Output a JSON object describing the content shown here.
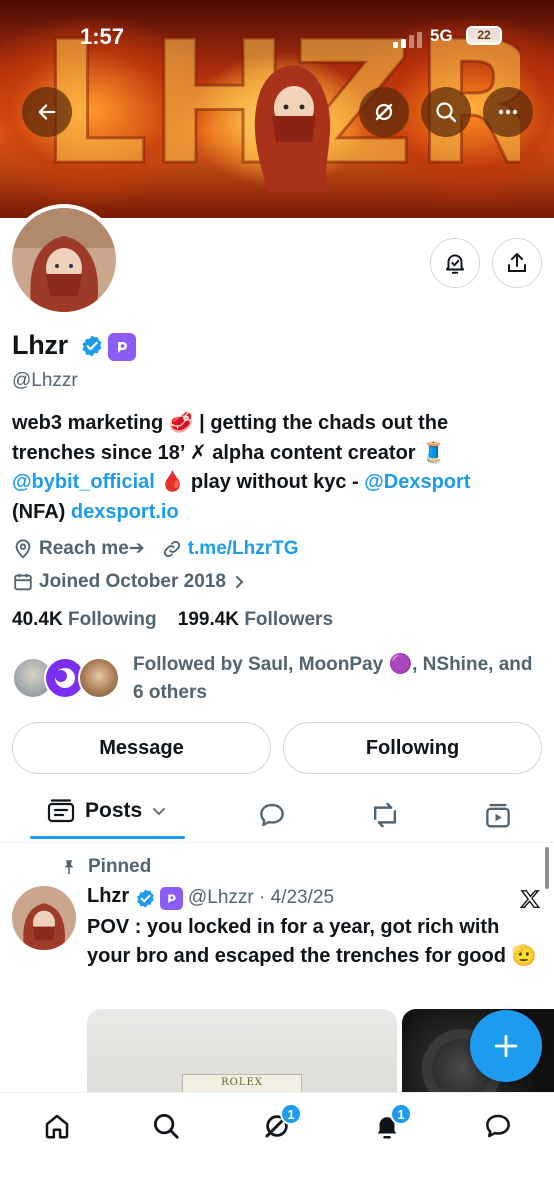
{
  "status_bar": {
    "time": "1:57",
    "network": "5G",
    "battery": "22"
  },
  "banner": {
    "letters": "LHZR"
  },
  "profile": {
    "name": "Lhzr",
    "handle": "@Lhzzr",
    "bio": {
      "line1": "web3 marketing 🥩 | getting the chads out the",
      "line2": "trenches since 18’ ✗ alpha content creator 🧵",
      "line3_link": "@bybit_official",
      "line3_emoji": "🩸",
      "line3_text": "play without kyc - ",
      "line3_link2": "@Dexsport",
      "line4_text": "(NFA) ",
      "line4_link": "dexsport.io"
    },
    "location": "Reach me➔",
    "website": "t.me/LhzrTG",
    "joined": "Joined October 2018",
    "following_count": "40.4K",
    "following_label": "Following",
    "followers_count": "199.4K",
    "followers_label": "Followers",
    "followed_by_line1": "Followed by Saul, MoonPay 🟣, NShine, and",
    "followed_by_line2": "6 others"
  },
  "actions": {
    "message": "Message",
    "following": "Following"
  },
  "tabs": {
    "posts": "Posts"
  },
  "pinned_post": {
    "pinned_label": "Pinned",
    "author": "Lhzr",
    "meta": "@Lhzzr · 4/23/25",
    "text": "POV : you locked in for a year, got rich with your bro and escaped the trenches for good 🫡",
    "media_label": "ROLEX"
  },
  "bottom_nav": {
    "grok_badge": "1",
    "notifications_badge": "1"
  },
  "colors": {
    "accent": "#1d9bf0",
    "text": "#0f1419",
    "secondary": "#536471",
    "border": "#cfd9de",
    "subscription_badge": "#8b5cf6"
  }
}
